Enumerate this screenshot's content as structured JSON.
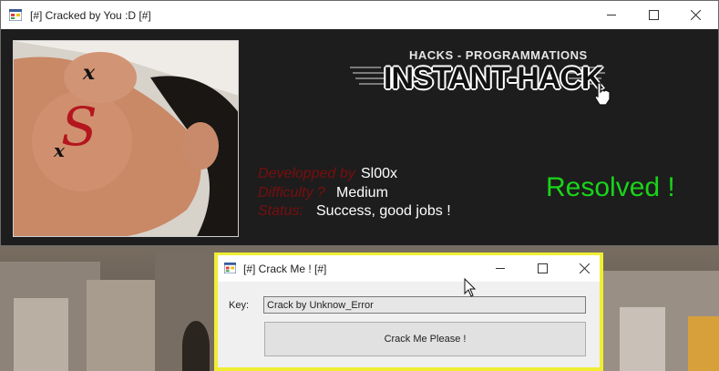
{
  "main_window": {
    "title": "[#] Cracked by You :D [#]",
    "photo_marks": [
      "x",
      "S",
      "x"
    ],
    "logo": {
      "subtitle": "HACKS - PROGRAMMATIONS",
      "title": "INSTANT-HACK"
    },
    "info": [
      {
        "label": "Developped by",
        "value": "Sl00x"
      },
      {
        "label": "Difficulty ?",
        "value": "Medium"
      },
      {
        "label": "Status:",
        "value": "Success, good jobs !"
      }
    ],
    "resolved_text": "Resolved !"
  },
  "dialog": {
    "title": "[#] Crack Me ! [#]",
    "key_label": "Key:",
    "key_value": "Crack by Unknow_Error",
    "button_label": "Crack Me Please !"
  },
  "colors": {
    "label_red": "#7a0e0e",
    "resolved_green": "#19d419",
    "dialog_frame": "#f0ee33",
    "main_bg": "#1d1d1d"
  },
  "icons": [
    "app-icon",
    "minimize-icon",
    "maximize-icon",
    "close-icon",
    "mouse-cursor-icon"
  ]
}
